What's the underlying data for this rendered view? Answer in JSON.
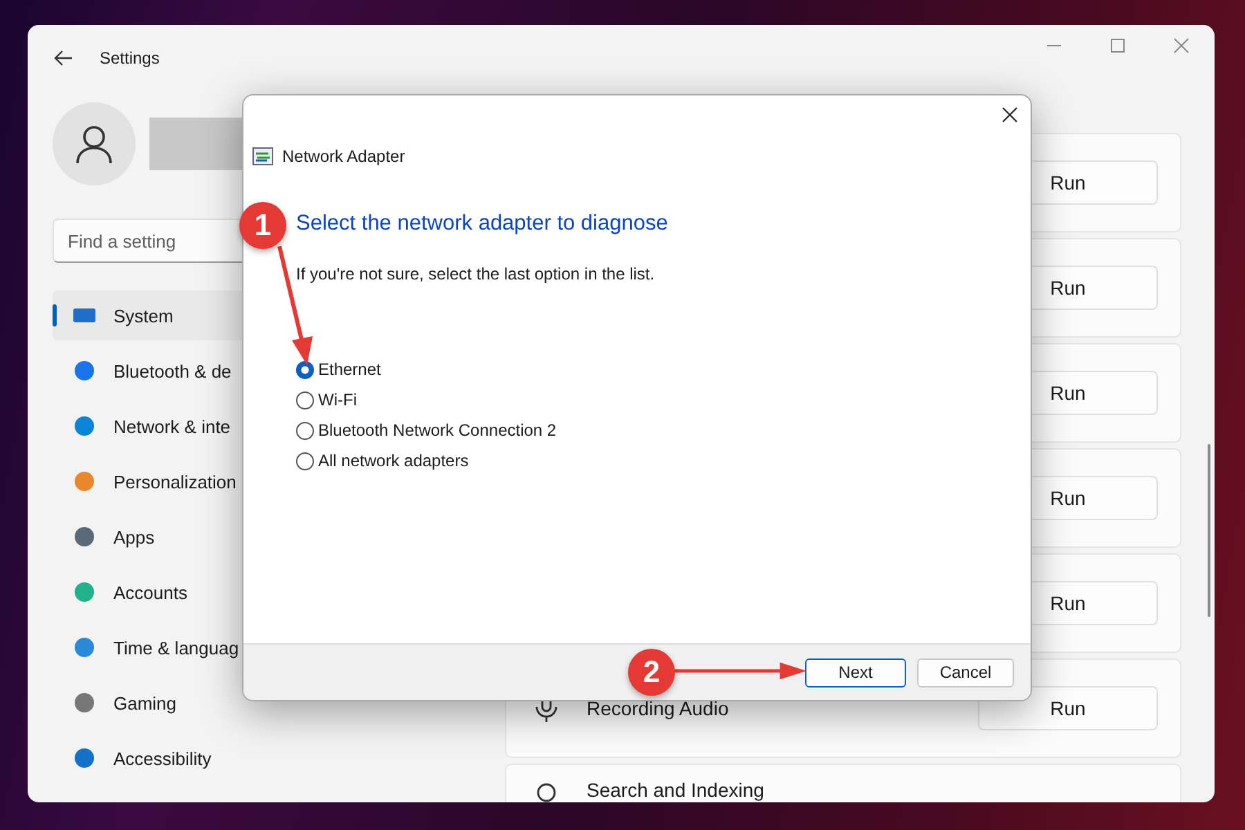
{
  "window": {
    "title": "Settings"
  },
  "sidebar": {
    "search": {
      "placeholder": "Find a setting"
    },
    "items": [
      {
        "label": "System",
        "selected": true
      },
      {
        "label": "Bluetooth & de",
        "selected": false
      },
      {
        "label": "Network & inte",
        "selected": false
      },
      {
        "label": "Personalization",
        "selected": false
      },
      {
        "label": "Apps",
        "selected": false
      },
      {
        "label": "Accounts",
        "selected": false
      },
      {
        "label": "Time & languag",
        "selected": false
      },
      {
        "label": "Gaming",
        "selected": false
      },
      {
        "label": "Accessibility",
        "selected": false
      }
    ]
  },
  "cards": [
    {
      "button": "Run"
    },
    {
      "button": "Run"
    },
    {
      "button": "Run"
    },
    {
      "button": "Run"
    },
    {
      "button": "Run"
    },
    {
      "label": "Recording Audio",
      "button": "Run"
    },
    {
      "label": "Search and Indexing"
    }
  ],
  "dialog": {
    "title": "Network Adapter",
    "heading": "Select the network adapter to diagnose",
    "instruction": "If you're not sure, select the last option in the list.",
    "options": [
      {
        "label": "Ethernet",
        "selected": true
      },
      {
        "label": "Wi-Fi",
        "selected": false
      },
      {
        "label": "Bluetooth Network Connection 2",
        "selected": false
      },
      {
        "label": "All network adapters",
        "selected": false
      }
    ],
    "buttons": [
      {
        "label": "Next",
        "kind": "default"
      },
      {
        "label": "Cancel",
        "kind": "normal"
      }
    ]
  },
  "annotations": [
    {
      "number": "1"
    },
    {
      "number": "2"
    }
  ]
}
